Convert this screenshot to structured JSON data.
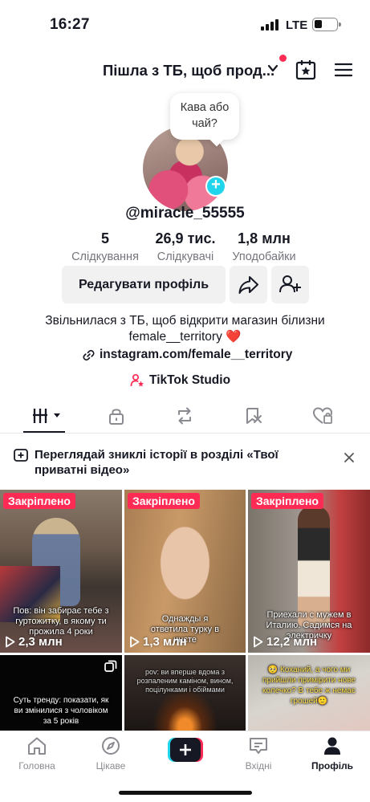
{
  "status_bar": {
    "time": "16:27",
    "network": "LTE"
  },
  "header": {
    "account_name": "Пішла з ТБ, щоб прод...",
    "has_notification": true
  },
  "profile": {
    "bubble_note": "Кава або чай?",
    "username": "@miracle_55555",
    "stats": [
      {
        "value": "5",
        "label": "Слідкування"
      },
      {
        "value": "26,9 тис.",
        "label": "Слідкувачі"
      },
      {
        "value": "1,8 млн",
        "label": "Уподобайки"
      }
    ],
    "edit_button": "Редагувати профіль",
    "bio_line1": "Звільнилася з ТБ, щоб відкрити магазин білизни",
    "bio_line2": "female__territory ❤️",
    "link": "instagram.com/female__territory",
    "studio": "TikTok Studio"
  },
  "tabs": [
    "videos-grid-icon",
    "lock-icon",
    "repost-icon",
    "favorites-icon",
    "liked-icon"
  ],
  "notice": {
    "text": "Переглядай зниклі історії в розділі «Твої приватні відео»"
  },
  "videos": [
    {
      "pinned": "Закріплено",
      "caption": "Пов: він забирає тебе з гуртожитку, в якому ти прожила 4 роки",
      "views": "2,3 млн"
    },
    {
      "pinned": "Закріплено",
      "caption": "Однажды я ответила турку в инсте",
      "views": "1,3 млн"
    },
    {
      "pinned": "Закріплено",
      "caption": "Приехали с мужем в Италию. Садимся на электричку",
      "views": "12,2 млн"
    },
    {
      "caption": "Суть тренду: показати, як ви змінилися з чоловіком за 5 років"
    },
    {
      "caption": "pov: ви вперше вдома з розпаленим каміном, вином, поцілунками і обіймами"
    },
    {
      "caption": "🥺 Коханий, а чого ми прийшли примірити нове колечко? В тебе ж немає грошей🙂"
    }
  ],
  "bottom_nav": [
    {
      "label": "Головна",
      "icon": "home-icon"
    },
    {
      "label": "Цікаве",
      "icon": "compass-icon"
    },
    {
      "label": "",
      "icon": "create-plus-icon"
    },
    {
      "label": "Вхідні",
      "icon": "inbox-icon"
    },
    {
      "label": "Профіль",
      "icon": "profile-icon"
    }
  ],
  "colors": {
    "accent": "#fe2c55",
    "cyan": "#20d5ec",
    "text": "#161823",
    "muted": "#74757c"
  }
}
